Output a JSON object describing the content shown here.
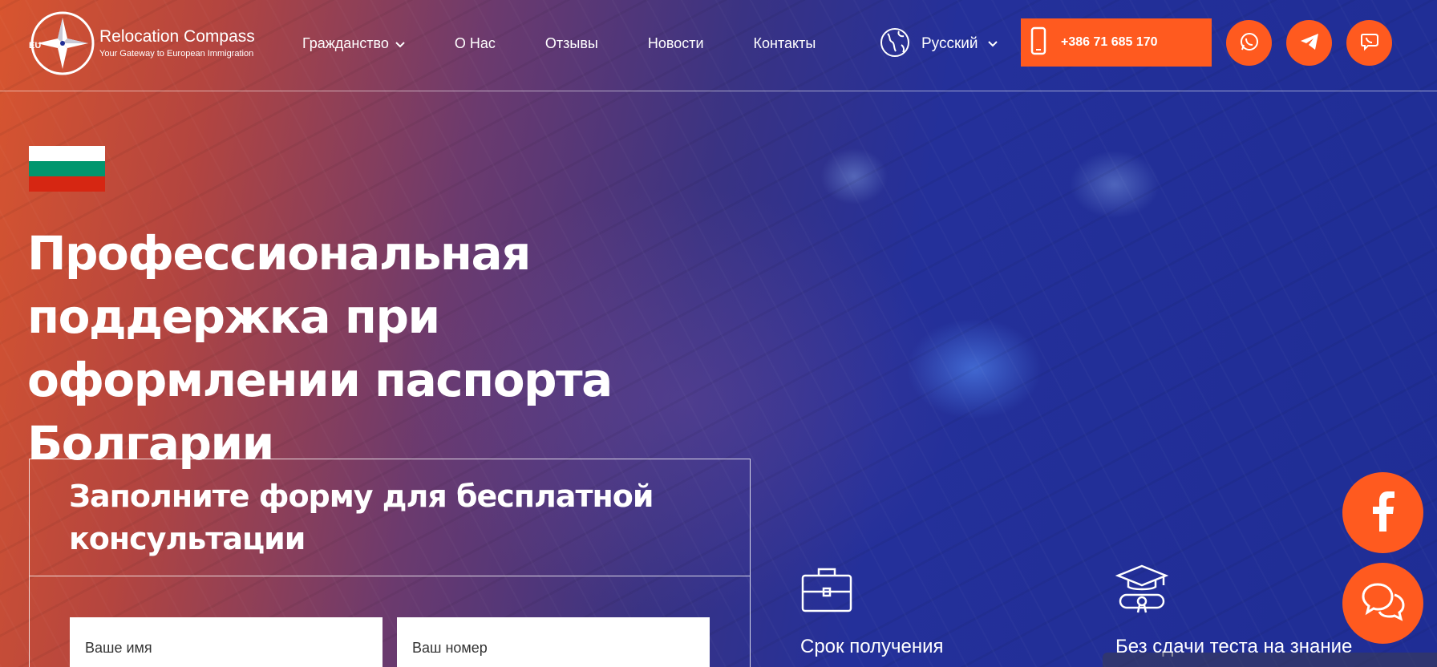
{
  "brand": {
    "name": "Relocation Compass",
    "tagline": "Your Gateway to European Immigration",
    "mark_text": "EU"
  },
  "nav": {
    "items": [
      {
        "label": "Гражданство",
        "has_dropdown": true
      },
      {
        "label": "О Нас",
        "has_dropdown": false
      },
      {
        "label": "Отзывы",
        "has_dropdown": false
      },
      {
        "label": "Новости",
        "has_dropdown": false
      },
      {
        "label": "Контакты",
        "has_dropdown": false
      }
    ]
  },
  "language": {
    "selected": "Русский",
    "icon": "globe-icon"
  },
  "contact": {
    "phone": "+386 71 685 170",
    "phone_icon": "mobile-phone-icon",
    "social": [
      "whatsapp-icon",
      "telegram-icon",
      "viber-icon"
    ]
  },
  "hero": {
    "flag_colors": [
      "#ffffff",
      "#00966e",
      "#d62612"
    ],
    "title": "Профессиональная поддержка при оформлении паспорта Болгарии"
  },
  "form": {
    "title": "Заполните форму для бесплатной консультации",
    "name_placeholder": "Ваше имя",
    "phone_placeholder": "Ваш номер"
  },
  "features": [
    {
      "icon": "briefcase-icon",
      "text": "Срок получения"
    },
    {
      "icon": "graduation-cap-diploma-icon",
      "text": "Без сдачи теста на знание"
    }
  ],
  "floating": {
    "facebook_icon": "facebook-icon",
    "chat_icon": "chat-bubbles-icon"
  },
  "colors": {
    "accent": "#ff5a1f",
    "overlay_left": "#d8552f",
    "overlay_right": "#1f2d95"
  }
}
